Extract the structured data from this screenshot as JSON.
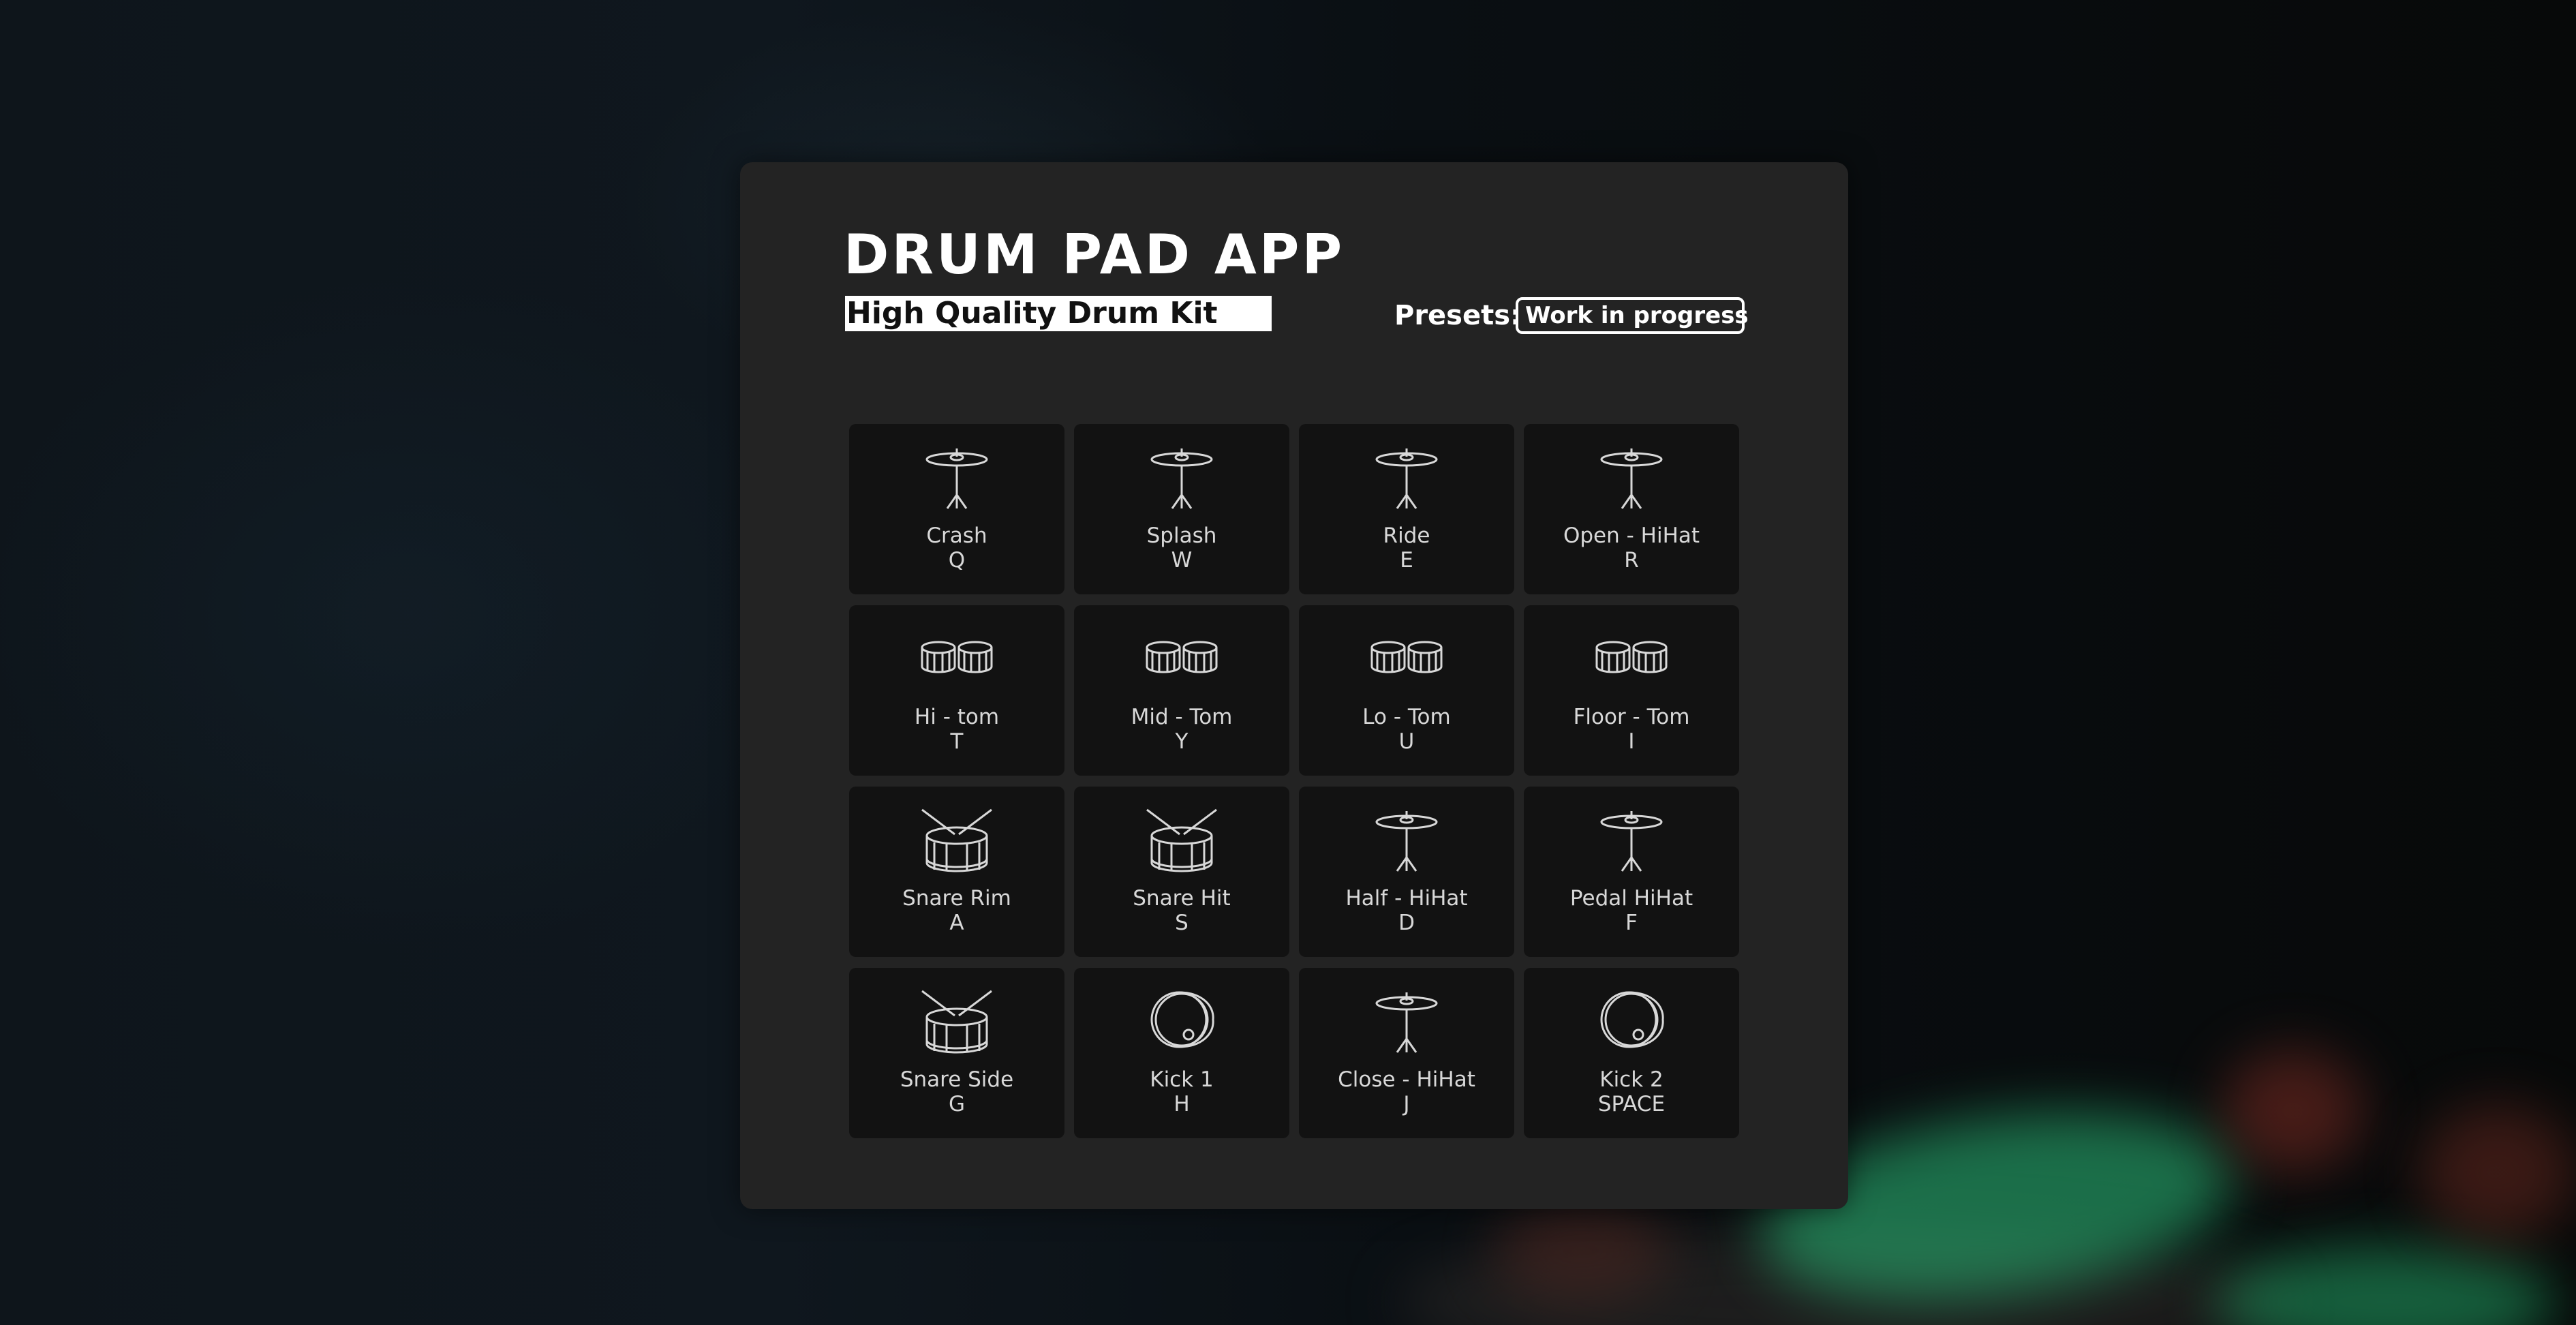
{
  "app": {
    "title": "DRUM PAD APP",
    "subtitle": "High Quality Drum Kit"
  },
  "presets": {
    "label": "Presets:",
    "selected": "Work in progress"
  },
  "pads": [
    {
      "name": "Crash",
      "key": "Q",
      "icon": "cymbal-icon"
    },
    {
      "name": "Splash",
      "key": "W",
      "icon": "cymbal-icon"
    },
    {
      "name": "Ride",
      "key": "E",
      "icon": "cymbal-icon"
    },
    {
      "name": "Open - HiHat",
      "key": "R",
      "icon": "cymbal-icon"
    },
    {
      "name": "Hi - tom",
      "key": "T",
      "icon": "tom-drums-icon"
    },
    {
      "name": "Mid - Tom",
      "key": "Y",
      "icon": "tom-drums-icon"
    },
    {
      "name": "Lo - Tom",
      "key": "U",
      "icon": "tom-drums-icon"
    },
    {
      "name": "Floor - Tom",
      "key": "I",
      "icon": "tom-drums-icon"
    },
    {
      "name": "Snare Rim",
      "key": "A",
      "icon": "snare-drum-icon"
    },
    {
      "name": "Snare Hit",
      "key": "S",
      "icon": "snare-drum-icon"
    },
    {
      "name": "Half - HiHat",
      "key": "D",
      "icon": "cymbal-icon"
    },
    {
      "name": "Pedal HiHat",
      "key": "F",
      "icon": "cymbal-icon"
    },
    {
      "name": "Snare Side",
      "key": "G",
      "icon": "snare-drum-icon"
    },
    {
      "name": "Kick 1",
      "key": "H",
      "icon": "kick-drum-icon"
    },
    {
      "name": "Close - HiHat",
      "key": "J",
      "icon": "cymbal-icon"
    },
    {
      "name": "Kick 2",
      "key": "SPACE",
      "icon": "kick-drum-icon"
    }
  ],
  "colors": {
    "panel": "#232323",
    "pad": "#121212",
    "text": "#d8d8d8",
    "accent_green": "#2bbf7a"
  }
}
